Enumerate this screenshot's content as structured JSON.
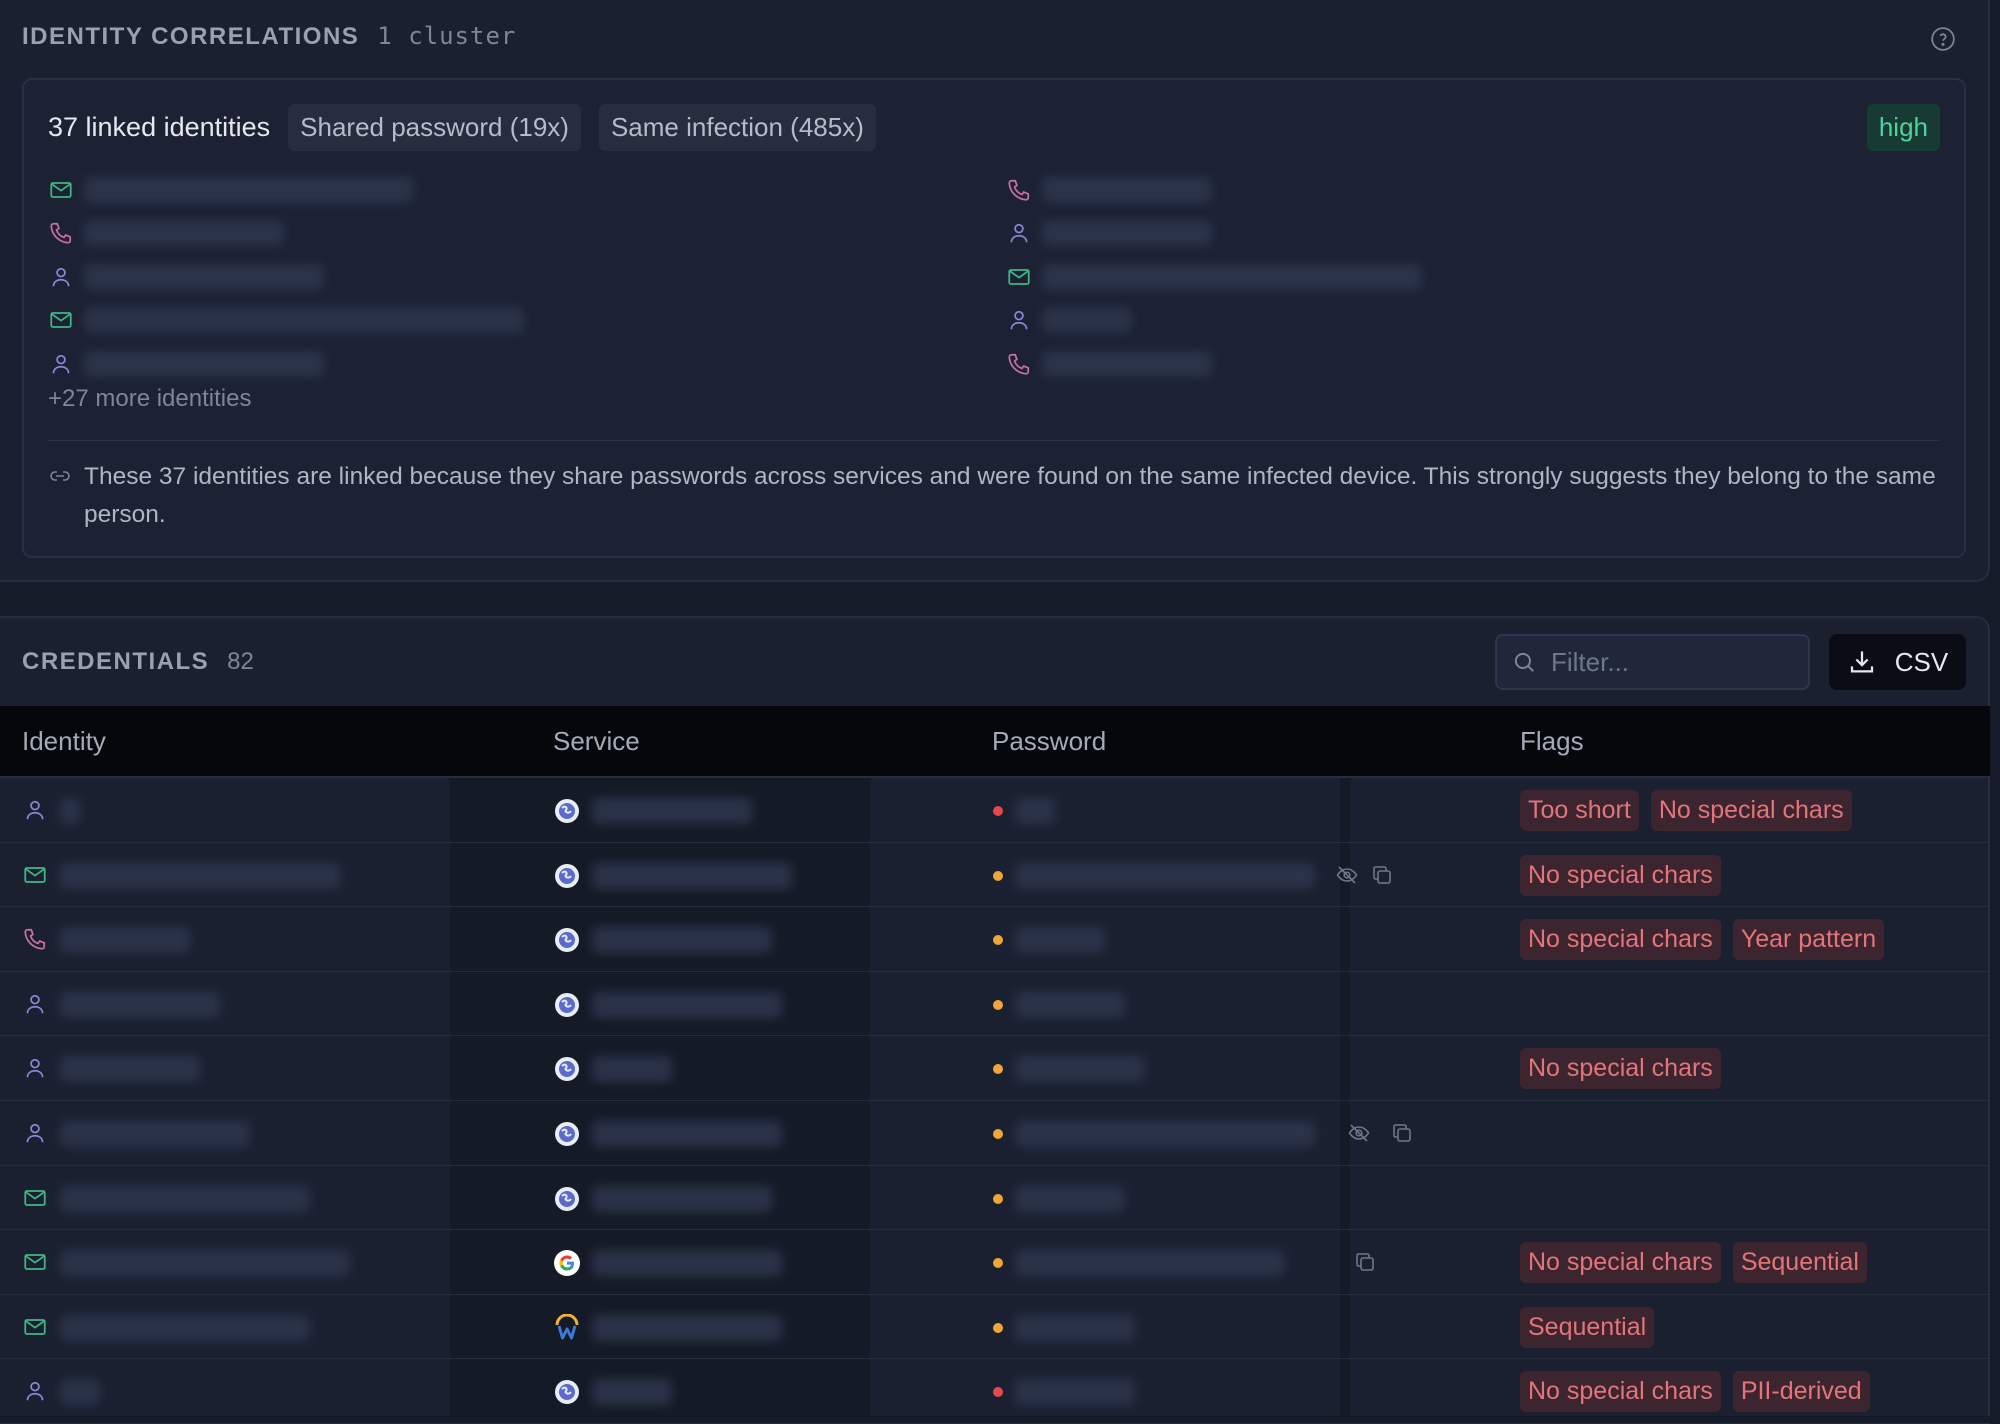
{
  "correlations": {
    "title": "IDENTITY CORRELATIONS",
    "count_label": "1 cluster",
    "cluster": {
      "title": "37 linked identities",
      "chips": [
        "Shared password (19x)",
        "Same infection (485x)"
      ],
      "risk": "high",
      "left_identities": [
        {
          "icon": "mail-icon"
        },
        {
          "icon": "phone-icon"
        },
        {
          "icon": "user-icon"
        },
        {
          "icon": "mail-icon"
        },
        {
          "icon": "user-icon"
        }
      ],
      "right_identities": [
        {
          "icon": "phone-icon"
        },
        {
          "icon": "user-icon"
        },
        {
          "icon": "mail-icon"
        },
        {
          "icon": "user-icon"
        },
        {
          "icon": "phone-icon"
        }
      ],
      "more_label": "+27 more identities",
      "explanation": "These 37 identities are linked because they share passwords across services and were found on the same infected device. This strongly suggests they belong to the same person."
    }
  },
  "credentials": {
    "title": "CREDENTIALS",
    "count": "82",
    "filter_placeholder": "Filter...",
    "csv_label": "CSV",
    "columns": [
      "Identity",
      "Service",
      "Password",
      "Flags"
    ],
    "rows": [
      {
        "icon": "user-icon",
        "service_icon": "globe-icon",
        "strength": "red",
        "flags": [
          "Too short",
          "No special chars"
        ]
      },
      {
        "icon": "mail-icon",
        "service_icon": "globe-icon",
        "strength": "orange",
        "flags": [
          "No special chars"
        ]
      },
      {
        "icon": "phone-icon",
        "service_icon": "globe-icon",
        "strength": "orange",
        "flags": [
          "No special chars",
          "Year pattern"
        ]
      },
      {
        "icon": "user-icon",
        "service_icon": "globe-icon",
        "strength": "orange",
        "flags": []
      },
      {
        "icon": "user-icon",
        "service_icon": "globe-icon",
        "strength": "orange",
        "flags": [
          "No special chars"
        ]
      },
      {
        "icon": "user-icon",
        "service_icon": "globe-icon",
        "strength": "orange",
        "flags": []
      },
      {
        "icon": "mail-icon",
        "service_icon": "globe-icon",
        "strength": "orange",
        "flags": []
      },
      {
        "icon": "mail-icon",
        "service_icon": "google-icon",
        "strength": "orange",
        "flags": [
          "No special chars",
          "Sequential"
        ]
      },
      {
        "icon": "mail-icon",
        "service_icon": "w-logo-icon",
        "strength": "orange",
        "flags": [
          "Sequential"
        ]
      },
      {
        "icon": "user-icon",
        "service_icon": "globe-icon",
        "strength": "red",
        "flags": [
          "No special chars",
          "PII-derived"
        ]
      }
    ]
  },
  "colors": {
    "mail": "#3fb883",
    "phone": "#c86fa6",
    "user": "#8a86d8",
    "strength_red": "#e5484d",
    "strength_orange": "#f0a53a",
    "risk_high": "#4ed39a"
  }
}
